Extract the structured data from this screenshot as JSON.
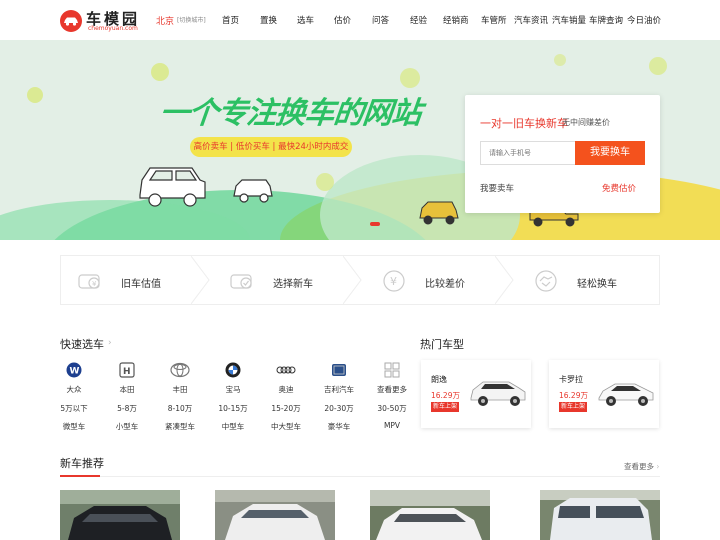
{
  "header": {
    "logo_name": "车模园",
    "logo_domain": "chemoyuan.com",
    "city": "北京",
    "city_switch": "[切换城市]",
    "nav": [
      "首页",
      "置换",
      "选车",
      "估价",
      "问答",
      "经验",
      "经销商",
      "车管所",
      "汽车资讯",
      "汽车销量",
      "车牌查询",
      "今日油价"
    ]
  },
  "banner": {
    "slogan": "一个专注换车的网站",
    "pill": "高价卖车 | 低价买车 | 最快24小时内成交",
    "card": {
      "title": "一对一旧车换新车",
      "subtitle": "无中间赚差价",
      "phone_placeholder": "请输入手机号",
      "button": "我要换车",
      "link_left": "我要卖车",
      "link_right": "免费估价"
    }
  },
  "steps": [
    "旧车估值",
    "选择新车",
    "比较差价",
    "轻松换车"
  ],
  "quick_select": {
    "title": "快速选车",
    "brands": [
      "大众",
      "本田",
      "丰田",
      "宝马",
      "奥迪",
      "吉利汽车",
      "查看更多"
    ],
    "prices": [
      "5万以下",
      "5-8万",
      "8-10万",
      "10-15万",
      "15-20万",
      "20-30万",
      "30-50万"
    ],
    "types": [
      "微型车",
      "小型车",
      "紧凑型车",
      "中型车",
      "中大型车",
      "豪华车",
      "MPV"
    ]
  },
  "hot_models": {
    "title": "热门车型",
    "items": [
      {
        "name": "朗逸",
        "price": "16.29万",
        "tag": "新车上架"
      },
      {
        "name": "卡罗拉",
        "price": "16.29万",
        "tag": "新车上架"
      }
    ]
  },
  "recommend": {
    "title": "新车推荐",
    "more": "查看更多"
  },
  "colors": {
    "brand_red": "#e8372c",
    "slogan_green": "#2cc064",
    "pill_yellow": "#f3e34a",
    "button_orange": "#f4521d"
  }
}
